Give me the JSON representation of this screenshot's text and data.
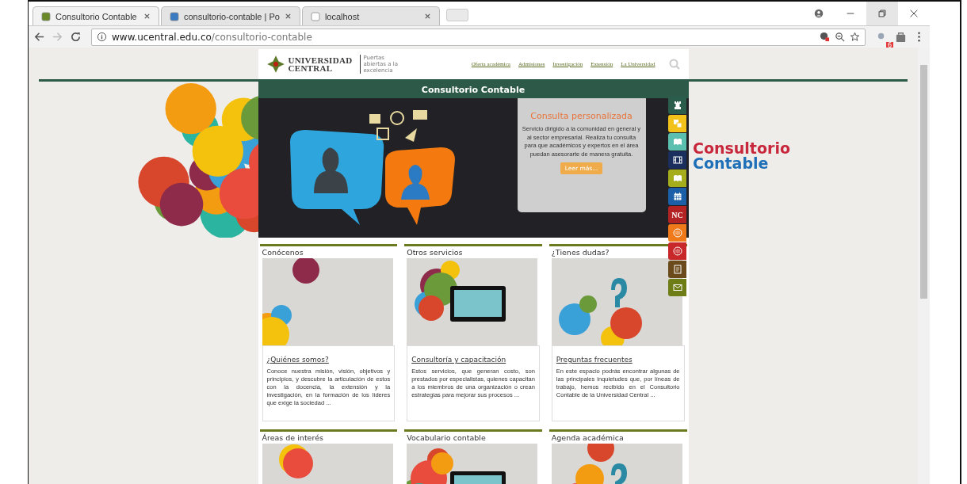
{
  "browser": {
    "tabs": [
      {
        "title": "Consultorio Contable",
        "selected": true
      },
      {
        "title": "consultorio-contable | Po",
        "selected": false
      },
      {
        "title": "localhost",
        "selected": false
      }
    ],
    "url_host": "www.ucentral.edu.co",
    "url_path": "/consultorio-contable",
    "extension_badge": "6"
  },
  "header": {
    "logo_line1": "UNIVERSIDAD",
    "logo_line2": "CENTRAL",
    "tagline": "Puertas abiertas a la excelencia",
    "nav": [
      "Oferta académica",
      "Admisiones",
      "Investigación",
      "Extensión",
      "La Universidad"
    ]
  },
  "section_title": "Consultorio Contable",
  "hero": {
    "title": "Consulta personalizada",
    "text": "Servicio dirigido a la comunidad en general y al sector empresarial. Realiza tu consulta para que académicos y expertos en el área puedan asesorarte de manera gratuita.",
    "button": "Leer más..."
  },
  "side_brand": {
    "line1": "Consultorio",
    "line2": "Contable"
  },
  "side_links": [
    {
      "kind": "rook",
      "color": "#2a5d4c"
    },
    {
      "kind": "cards",
      "color": "#f2c21a"
    },
    {
      "kind": "book",
      "color": "#5bbfb0"
    },
    {
      "kind": "film",
      "color": "#1b2f5e"
    },
    {
      "kind": "book",
      "color": "#a5ad1c"
    },
    {
      "kind": "calendar",
      "color": "#1b5fa8"
    },
    {
      "kind": "text",
      "color": "#b32324",
      "label": "NC"
    },
    {
      "kind": "seal",
      "color": "#f07a1a"
    },
    {
      "kind": "seal",
      "color": "#c8282a"
    },
    {
      "kind": "document",
      "color": "#6b4a1c"
    },
    {
      "kind": "mail",
      "color": "#6e7d16"
    }
  ],
  "cards": [
    {
      "title": "Conócenos",
      "link": "¿Quiénes somos?",
      "text": "Conoce nuestra misión, visión, objetivos y principios, y descubre la articulación de estos con la docencia, la extensión y la investigación, en la formación de los líderes que exige la sociedad ..."
    },
    {
      "title": "Otros servicios",
      "link": "Consultoría y capacitación",
      "text": "Estos servicios, que generan costo, son prestados por especialistas, quienes capacitan a los miembros de una organización o crean estrategias para mejorar sus procesos ..."
    },
    {
      "title": "¿Tienes dudas?",
      "link": "Preguntas frecuentes",
      "text": "En este espacio podrás encontrar algunas de las principales inquietudes que, por líneas de trabajo, hemos recibido en el Consultorio Contable de la Universidad Central ..."
    },
    {
      "title": "Áreas de interés"
    },
    {
      "title": "Vocabulario contable"
    },
    {
      "title": "Agenda académica"
    }
  ]
}
